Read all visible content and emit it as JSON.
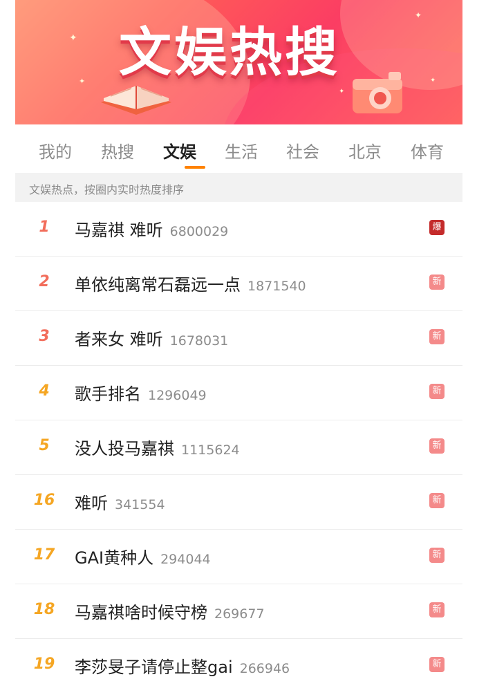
{
  "banner": {
    "title": "文娱热搜"
  },
  "tabs": [
    {
      "label": "我的",
      "active": false
    },
    {
      "label": "热搜",
      "active": false
    },
    {
      "label": "文娱",
      "active": true
    },
    {
      "label": "生活",
      "active": false
    },
    {
      "label": "社会",
      "active": false
    },
    {
      "label": "北京",
      "active": false
    },
    {
      "label": "体育",
      "active": false
    }
  ],
  "subtitle": "文娱热点，按圈内实时热度排序",
  "colors": {
    "rank_top3": "#f26d5b",
    "rank_rest": "#f5a623",
    "badge_hot": "#c42b2b",
    "badge_new": "#f48a8a",
    "tab_underline": "#ff8200"
  },
  "list": [
    {
      "rank": "1",
      "title": "马嘉祺 难听",
      "count": "6800029",
      "badge": "爆",
      "badge_type": "hot"
    },
    {
      "rank": "2",
      "title": "单依纯离常石磊远一点",
      "count": "1871540",
      "badge": "新",
      "badge_type": "new"
    },
    {
      "rank": "3",
      "title": "者来女 难听",
      "count": "1678031",
      "badge": "新",
      "badge_type": "new"
    },
    {
      "rank": "4",
      "title": "歌手排名",
      "count": "1296049",
      "badge": "新",
      "badge_type": "new"
    },
    {
      "rank": "5",
      "title": "没人投马嘉祺",
      "count": "1115624",
      "badge": "新",
      "badge_type": "new"
    },
    {
      "rank": "16",
      "title": "难听",
      "count": "341554",
      "badge": "新",
      "badge_type": "new"
    },
    {
      "rank": "17",
      "title": "GAI黄种人",
      "count": "294044",
      "badge": "新",
      "badge_type": "new"
    },
    {
      "rank": "18",
      "title": "马嘉祺啥时候守榜",
      "count": "269677",
      "badge": "新",
      "badge_type": "new"
    },
    {
      "rank": "19",
      "title": "李莎旻子请停止整gai",
      "count": "266946",
      "badge": "新",
      "badge_type": "new"
    }
  ]
}
